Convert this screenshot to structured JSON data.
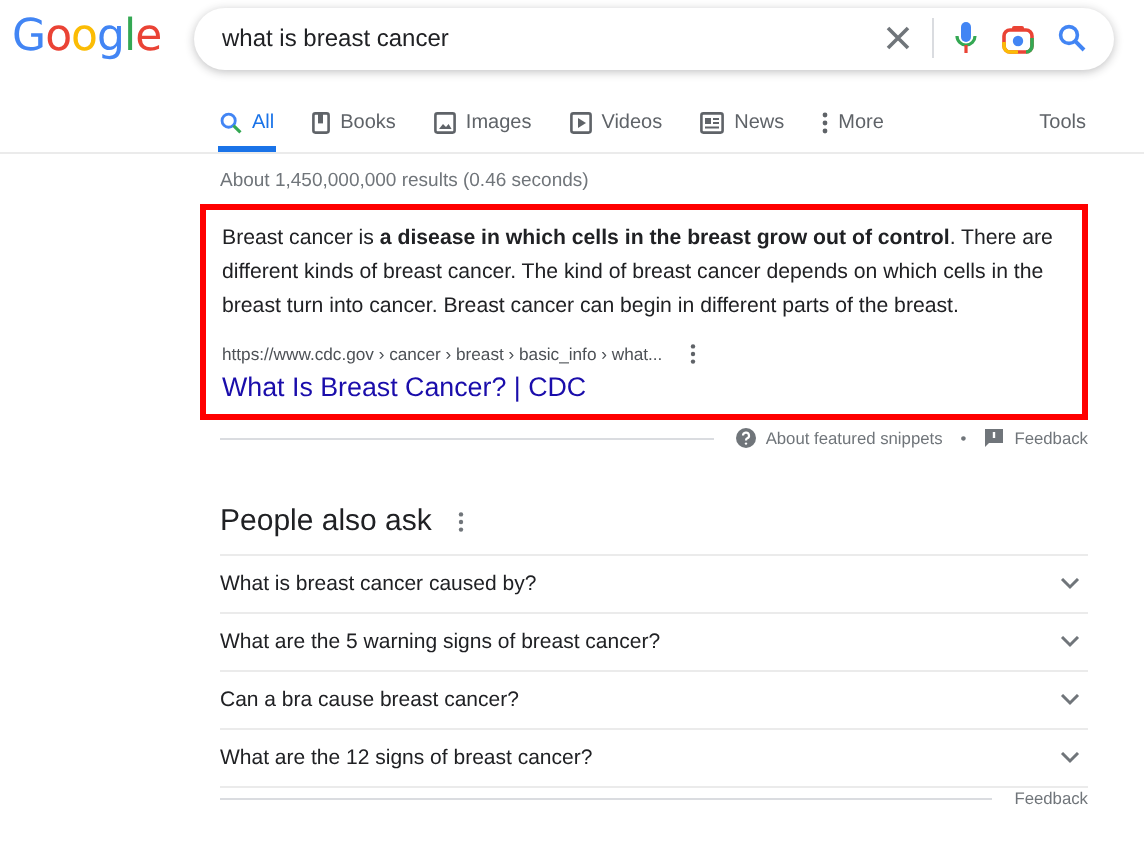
{
  "logo": "Google",
  "search": {
    "value": "what is breast cancer"
  },
  "tabs": [
    {
      "label": "All",
      "selected": true
    },
    {
      "label": "Books",
      "selected": false
    },
    {
      "label": "Images",
      "selected": false
    },
    {
      "label": "Videos",
      "selected": false
    },
    {
      "label": "News",
      "selected": false
    },
    {
      "label": "More",
      "selected": false
    }
  ],
  "tools": "Tools",
  "result_stats": "About 1,450,000,000 results (0.46 seconds)",
  "featured_snippet": {
    "highlighted": true,
    "text": "Breast cancer is **a disease in which cells in the breast grow out of control**. There are different kinds of breast cancer. The kind of breast cancer depends on which cells in the breast turn into cancer. Breast cancer can begin in different parts of the breast.",
    "url": "https://www.cdc.gov › cancer › breast › basic_info › what...",
    "title": "What Is Breast Cancer? | CDC",
    "about": "About featured snippets",
    "separator": "•",
    "feedback": "Feedback"
  },
  "people_also_ask": {
    "heading": "People also ask",
    "questions": [
      {
        "text": "What is breast cancer caused by?",
        "expanded": false
      },
      {
        "text": "What are the 5 warning signs of breast cancer?",
        "expanded": false
      },
      {
        "text": "Can a bra cause breast cancer?",
        "expanded": false
      },
      {
        "text": "What are the 12 signs of breast cancer?",
        "expanded": false
      }
    ],
    "feedback": "Feedback"
  }
}
